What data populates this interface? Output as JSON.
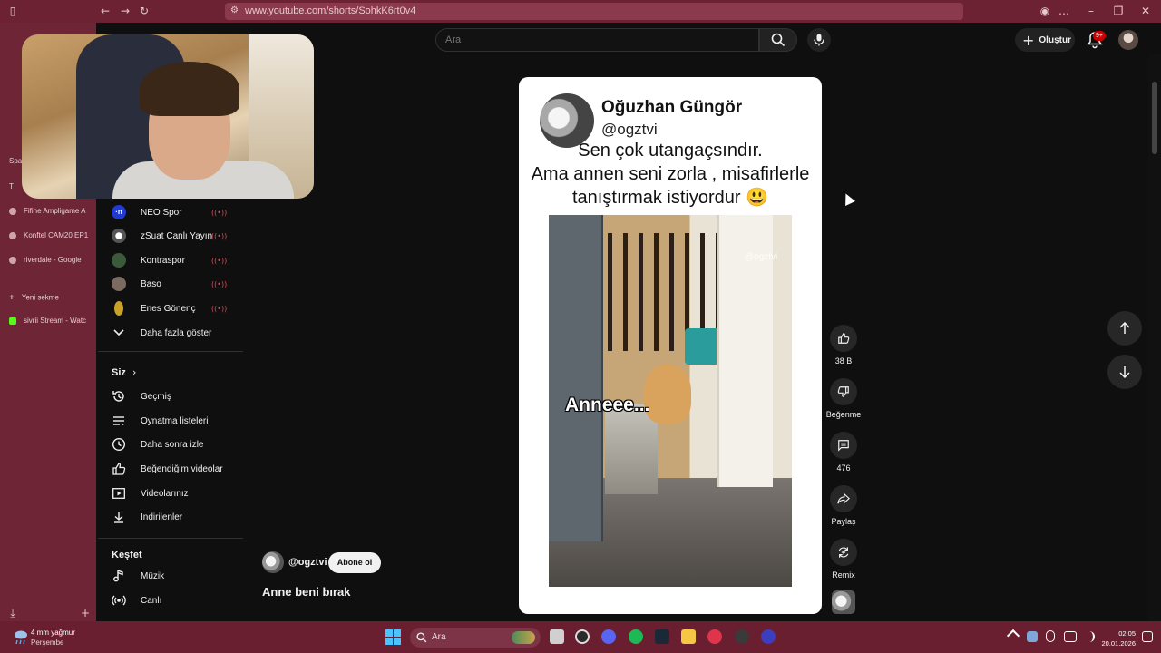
{
  "browser": {
    "url": "www.youtube.com/shorts/SohkK6rt0v4"
  },
  "tab_strip": {
    "items": [
      {
        "label": "Spa"
      },
      {
        "label": "T"
      },
      {
        "label": "Fifine Ampligame A"
      },
      {
        "label": "Konftel CAM20 EP1"
      },
      {
        "label": "riverdale - Google"
      },
      {
        "label": "Yeni sekme"
      },
      {
        "label": "sivrii Stream - Watc"
      }
    ]
  },
  "header": {
    "search_placeholder": "Ara",
    "create_label": "Oluştur",
    "notification_badge": "9+"
  },
  "sidebar": {
    "subscriptions": [
      {
        "label": "NEO Spor",
        "live": "((•))"
      },
      {
        "label": "zSuat Canlı Yayın",
        "live": "((•))"
      },
      {
        "label": "Kontraspor",
        "live": "((•))"
      },
      {
        "label": "Baso",
        "live": "((•))"
      },
      {
        "label": "Enes Gönenç",
        "live": "((•))"
      }
    ],
    "show_more": "Daha fazla göster",
    "you_title": "Siz",
    "you_items": [
      {
        "label": "Geçmiş"
      },
      {
        "label": "Oynatma listeleri"
      },
      {
        "label": "Daha sonra izle"
      },
      {
        "label": "Beğendiğim videolar"
      },
      {
        "label": "Videolarınız"
      },
      {
        "label": "İndirilenler"
      }
    ],
    "explore_title": "Keşfet",
    "explore_items": [
      {
        "label": "Müzik"
      },
      {
        "label": "Canlı"
      }
    ]
  },
  "short": {
    "tweet_name": "Oğuzhan Güngör",
    "tweet_handle": "@ogztvi",
    "tweet_line1": "Sen çok utangaçsındır.",
    "tweet_line2": "Ama annen seni zorla , misafirlerle",
    "tweet_line3": "tanıştırmak istiyordur 😃",
    "video_caption": "Anneee...",
    "video_watermark": "@ogztvi",
    "channel": "@ogztvi",
    "subscribe_label": "Abone ol",
    "title": "Anne beni bırak"
  },
  "actions": {
    "likes": "38 B",
    "dislike_label": "Beğenme",
    "comments": "476",
    "share_label": "Paylaş",
    "remix_label": "Remix"
  },
  "taskbar": {
    "weather_line1": "4 mm yağmur",
    "weather_line2": "Perşembe",
    "search_label": "Ara",
    "time": "02:05",
    "date": "20.01.2026"
  },
  "colors": {
    "brand_red": "#cc0000",
    "chrome_bg": "#6d2233",
    "page_bg": "#0f0f0f"
  }
}
